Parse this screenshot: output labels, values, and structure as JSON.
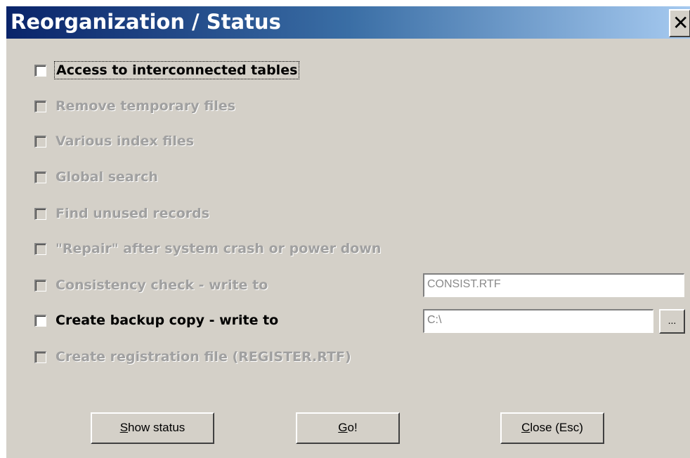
{
  "window": {
    "title": "Reorganization / Status",
    "close_glyph": "✕",
    "close_icon": "close-icon"
  },
  "options": [
    {
      "label": "Access to interconnected tables",
      "enabled": true,
      "checked": false,
      "focused": true
    },
    {
      "label": "Remove temporary files",
      "enabled": false,
      "checked": false
    },
    {
      "label": "Various index files",
      "enabled": false,
      "checked": false
    },
    {
      "label": "Global search",
      "enabled": false,
      "checked": false
    },
    {
      "label": "Find unused records",
      "enabled": false,
      "checked": false
    },
    {
      "label": "\"Repair\" after system crash or power down",
      "enabled": false,
      "checked": false
    },
    {
      "label": "Consistency check - write to",
      "enabled": false,
      "checked": false
    },
    {
      "label": "Create backup copy - write to",
      "enabled": true,
      "checked": false
    },
    {
      "label": "Create registration file (REGISTER.RTF)",
      "enabled": false,
      "checked": false
    }
  ],
  "fields": {
    "consistency_file": {
      "value": "CONSIST.RTF",
      "enabled": false
    },
    "backup_path": {
      "value": "C:\\",
      "enabled": true
    },
    "browse_label": "..."
  },
  "buttons": {
    "show_status": {
      "accel": "S",
      "rest": "how status"
    },
    "go": {
      "accel": "G",
      "rest": "o!"
    },
    "close": {
      "accel": "C",
      "rest": "lose (Esc)"
    }
  },
  "colors": {
    "title_gradient_start": "#0a246a",
    "title_gradient_end": "#a6caf0",
    "dialog_face": "#d4d0c8",
    "disabled_text": "#a0a0a0"
  }
}
